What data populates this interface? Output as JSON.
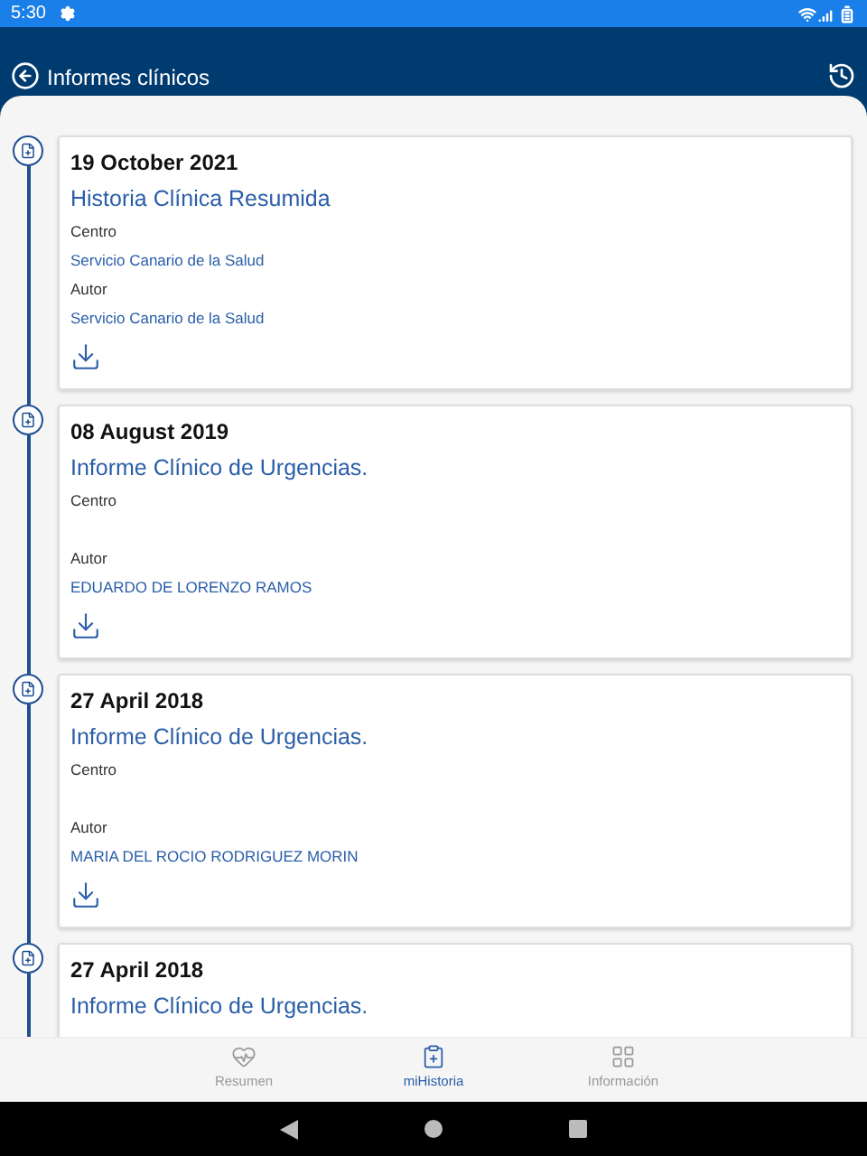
{
  "status_bar": {
    "time": "5:30"
  },
  "header": {
    "title": "Informes clínicos"
  },
  "reports": [
    {
      "date": "19 October 2021",
      "title": "Historia Clínica Resumida",
      "center_label": "Centro",
      "center": "Servicio Canario de la Salud",
      "author_label": "Autor",
      "author": "Servicio Canario de la Salud"
    },
    {
      "date": "08 August 2019",
      "title": "Informe Clínico de Urgencias.",
      "center_label": "Centro",
      "author_label": "Autor",
      "author": "EDUARDO DE LORENZO RAMOS"
    },
    {
      "date": "27 April 2018",
      "title": "Informe Clínico de Urgencias.",
      "center_label": "Centro",
      "author_label": "Autor",
      "author": "MARIA DEL ROCIO RODRIGUEZ MORIN"
    },
    {
      "date": "27 April 2018",
      "title": "Informe Clínico de Urgencias."
    }
  ],
  "bottom_nav": [
    {
      "label": "Resumen",
      "selected": false
    },
    {
      "label": "miHistoria",
      "selected": true
    },
    {
      "label": "Información",
      "selected": false
    }
  ]
}
